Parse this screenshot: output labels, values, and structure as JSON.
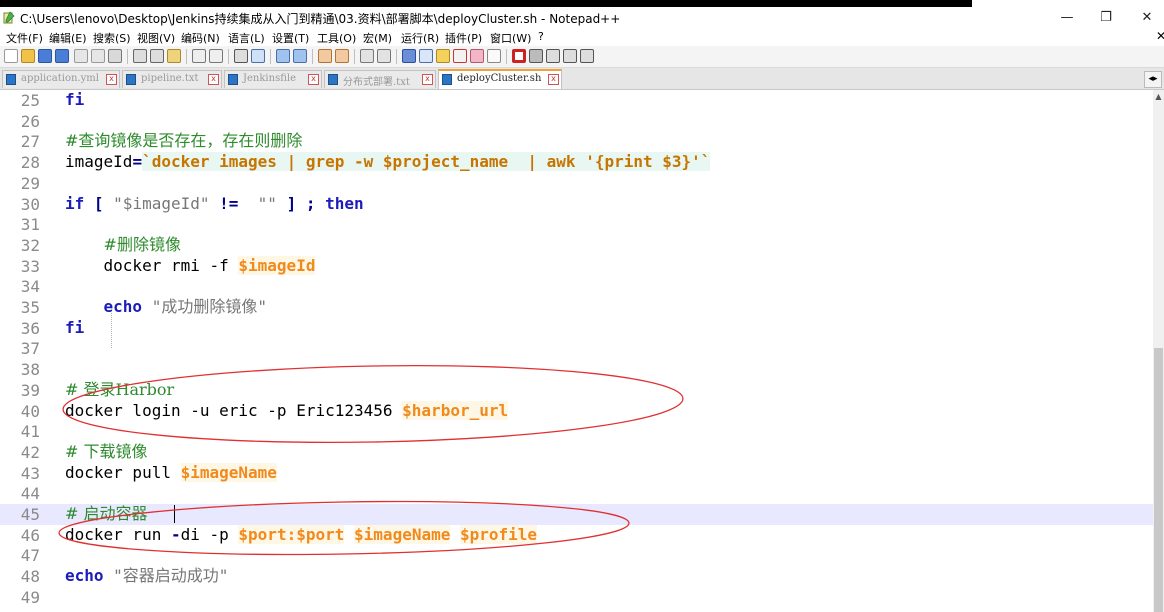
{
  "window": {
    "title": "C:\\Users\\lenovo\\Desktop\\Jenkins持续集成从入门到精通\\03.资料\\部署脚本\\deployCluster.sh - Notepad++",
    "minimize": "—",
    "restore": "❐",
    "close": "✕"
  },
  "menu": [
    "文件(F)",
    "编辑(E)",
    "搜索(S)",
    "视图(V)",
    "编码(N)",
    "语言(L)",
    "设置(T)",
    "工具(O)",
    "宏(M)",
    "运行(R)",
    "插件(P)",
    "窗口(W)",
    "?"
  ],
  "menu_close": "✕",
  "tabs": [
    {
      "label": "application.yml",
      "active": false
    },
    {
      "label": "pipeline.txt",
      "active": false
    },
    {
      "label": "Jenkinsfile",
      "active": false
    },
    {
      "label": "分布式部署.txt",
      "active": false
    },
    {
      "label": "deployCluster.sh",
      "active": true
    }
  ],
  "tab_close": "x",
  "tab_scroll": "◂▸",
  "editor": {
    "current_line": 45,
    "lines": [
      {
        "n": "25",
        "tokens": [
          {
            "t": "fi",
            "c": "kw"
          }
        ]
      },
      {
        "n": "26",
        "tokens": []
      },
      {
        "n": "27",
        "tokens": [
          {
            "t": "#查询镜像是否存在，存在则删除",
            "c": "cm"
          }
        ]
      },
      {
        "n": "28",
        "tokens": [
          {
            "t": "imageId",
            "c": "plain"
          },
          {
            "t": "=",
            "c": "op"
          },
          {
            "t": "`docker images | grep -w $project_name  | awk '{print $3}'`",
            "c": "bt"
          }
        ]
      },
      {
        "n": "29",
        "tokens": []
      },
      {
        "n": "30",
        "tokens": [
          {
            "t": "if",
            "c": "kw"
          },
          {
            "t": " [ ",
            "c": "op"
          },
          {
            "t": "\"$imageId\"",
            "c": "str"
          },
          {
            "t": " != ",
            "c": "op"
          },
          {
            "t": " \"\"",
            "c": "str"
          },
          {
            "t": " ] ; ",
            "c": "op"
          },
          {
            "t": "then",
            "c": "kw"
          }
        ]
      },
      {
        "n": "31",
        "tokens": []
      },
      {
        "n": "32",
        "tokens": [
          {
            "t": "    ",
            "c": "plain"
          },
          {
            "t": "#删除镜像",
            "c": "cm"
          }
        ]
      },
      {
        "n": "33",
        "tokens": [
          {
            "t": "    docker rmi -f ",
            "c": "plain"
          },
          {
            "t": "$imageId",
            "c": "var"
          }
        ]
      },
      {
        "n": "34",
        "tokens": []
      },
      {
        "n": "35",
        "tokens": [
          {
            "t": "    ",
            "c": "plain"
          },
          {
            "t": "echo",
            "c": "kw"
          },
          {
            "t": " \"成功删除镜像\"",
            "c": "str"
          }
        ]
      },
      {
        "n": "36",
        "tokens": [
          {
            "t": "fi",
            "c": "kw"
          }
        ]
      },
      {
        "n": "37",
        "tokens": []
      },
      {
        "n": "38",
        "tokens": []
      },
      {
        "n": "39",
        "tokens": [
          {
            "t": "# 登录Harbor",
            "c": "cm"
          }
        ]
      },
      {
        "n": "40",
        "tokens": [
          {
            "t": "docker login -u eric -p Eric123456 ",
            "c": "plain"
          },
          {
            "t": "$harbor_url",
            "c": "var"
          }
        ]
      },
      {
        "n": "41",
        "tokens": []
      },
      {
        "n": "42",
        "tokens": [
          {
            "t": "# 下载镜像",
            "c": "cm"
          }
        ]
      },
      {
        "n": "43",
        "tokens": [
          {
            "t": "docker pull ",
            "c": "plain"
          },
          {
            "t": "$imageName",
            "c": "var"
          }
        ]
      },
      {
        "n": "44",
        "tokens": []
      },
      {
        "n": "45",
        "tokens": [
          {
            "t": "# 启动容器",
            "c": "cm"
          }
        ]
      },
      {
        "n": "46",
        "tokens": [
          {
            "t": "docker run ",
            "c": "plain"
          },
          {
            "t": "-",
            "c": "op"
          },
          {
            "t": "di -p ",
            "c": "plain"
          },
          {
            "t": "$port",
            "c": "var"
          },
          {
            "t": ":",
            "c": "var"
          },
          {
            "t": "$port",
            "c": "var"
          },
          {
            "t": " ",
            "c": "plain"
          },
          {
            "t": "$imageName",
            "c": "var"
          },
          {
            "t": " ",
            "c": "plain"
          },
          {
            "t": "$profile",
            "c": "var"
          }
        ]
      },
      {
        "n": "47",
        "tokens": []
      },
      {
        "n": "48",
        "tokens": [
          {
            "t": "echo",
            "c": "kw"
          },
          {
            "t": " \"容器启动成功\"",
            "c": "str"
          }
        ]
      },
      {
        "n": "49",
        "tokens": []
      }
    ]
  },
  "colors": {
    "keyword": "#1c1cba",
    "comment": "#2e8b2e",
    "variable": "#f08a1c",
    "annotation": "#e03030",
    "active_tab_accent": "#f2a13a"
  }
}
